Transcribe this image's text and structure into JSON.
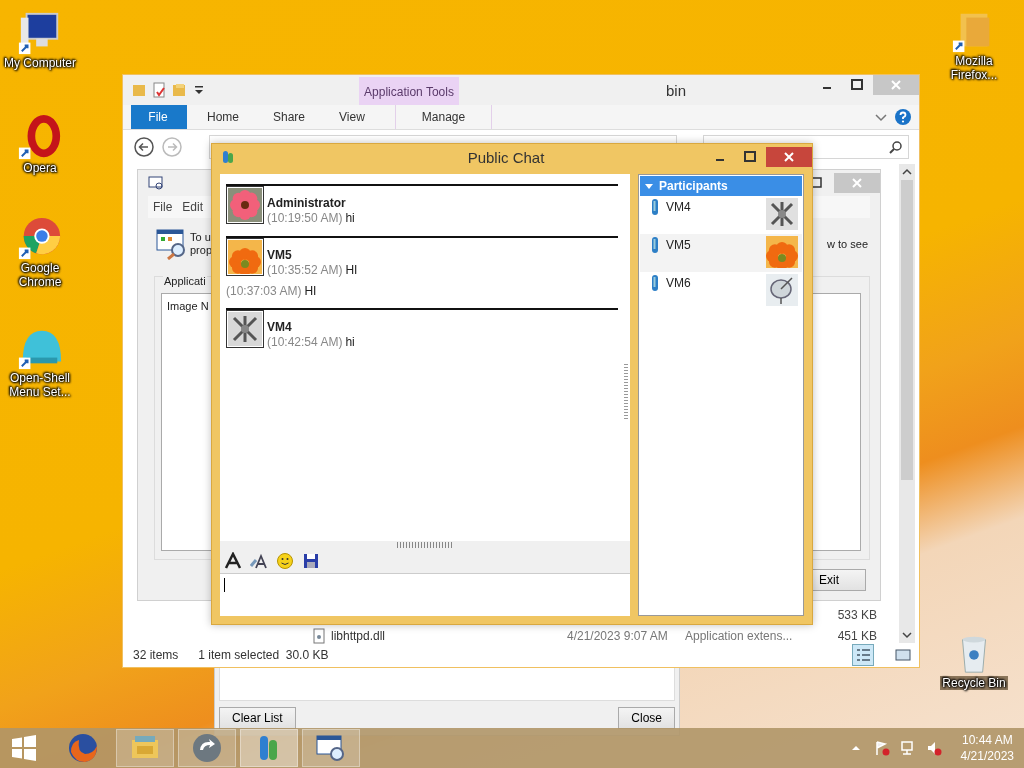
{
  "desktop_icons": [
    {
      "label": "My Computer",
      "kind": "computer"
    },
    {
      "label": "Opera",
      "kind": "opera"
    },
    {
      "label": "Google Chrome",
      "kind": "chrome"
    },
    {
      "label": "Open-Shell Menu Set...",
      "kind": "shell"
    },
    {
      "label": "Mozilla Firefox...",
      "kind": "folder"
    },
    {
      "label": "Recycle Bin",
      "kind": "recycle"
    }
  ],
  "list_dialog": {
    "buttons": [
      "Clear List",
      "Close"
    ]
  },
  "explorer": {
    "title": "bin",
    "file_tab": "File",
    "tabs": [
      "Home",
      "Share",
      "View"
    ],
    "contextual": {
      "label": "Application Tools",
      "tabs": [
        "Manage"
      ]
    },
    "rows": [
      {
        "size": "533 KB"
      },
      {
        "name": "libhttpd.dll",
        "date": "4/21/2023 9:07 AM",
        "type": "Application extens...",
        "size": "451 KB"
      }
    ],
    "status_count": "32 items",
    "status_selection": "1 item selected  30.0 KB"
  },
  "app_dialog": {
    "menu": [
      "File",
      "Edit"
    ],
    "intro_lines": [
      "To u",
      "prop"
    ],
    "intro_tail": "w to see",
    "group_label": "Applicati",
    "column": "Image N",
    "exit_button": "Exit"
  },
  "chat": {
    "title": "Public Chat",
    "messages": [
      {
        "sender": "Administrator",
        "lines": [
          {
            "time": "(10:19:50 AM)",
            "text": "hi"
          }
        ]
      },
      {
        "sender": "VM5",
        "lines": [
          {
            "time": "(10:35:52 AM)",
            "text": "HI"
          },
          {
            "time": "(10:37:03 AM)",
            "text": "HI"
          }
        ]
      },
      {
        "sender": "VM4",
        "lines": [
          {
            "time": "(10:42:54 AM)",
            "text": "hi"
          }
        ]
      }
    ],
    "participants": {
      "title": "Participants",
      "expanded": true,
      "items": [
        {
          "name": "VM4",
          "selected": false
        },
        {
          "name": "VM5",
          "selected": true
        },
        {
          "name": "VM6",
          "selected": false
        }
      ]
    }
  },
  "taskbar": {
    "apps": [
      {
        "kind": "firefox",
        "running": false,
        "active": false
      },
      {
        "kind": "explorer",
        "running": true,
        "active": false
      },
      {
        "kind": "sync",
        "running": true,
        "active": false
      },
      {
        "kind": "chat",
        "running": true,
        "active": true
      },
      {
        "kind": "monitor",
        "running": true,
        "active": false
      }
    ],
    "clock": {
      "time": "10:44 AM",
      "date": "4/21/2023"
    }
  }
}
